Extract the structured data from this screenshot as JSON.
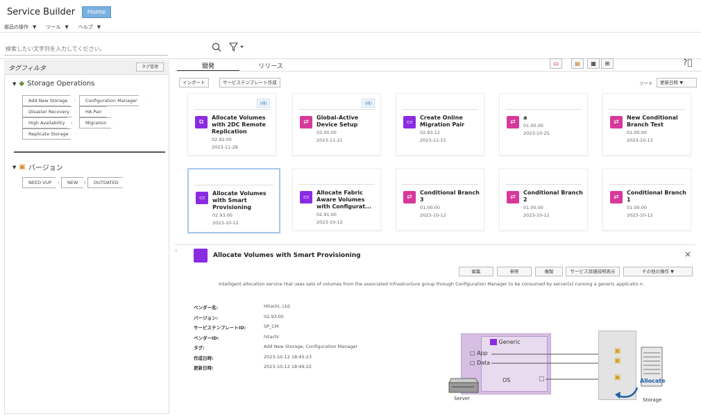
{
  "app": {
    "title": "Service Builder",
    "home_tab": "Home"
  },
  "menu": {
    "items": [
      "部品の操作",
      "ツール",
      "ヘルプ"
    ]
  },
  "search": {
    "placeholder": "検索したい文字列を入力してください。"
  },
  "left": {
    "title": "タグフィルタ",
    "tag_manage": "タグ管理",
    "group1": "Storage Operations",
    "group1_tags": [
      "Add New Storage",
      "Configuration Manager",
      "Disaster Recovery",
      "HA Pair",
      "High Availability",
      "Migration",
      "Replicate Storage"
    ],
    "group2": "バージョン",
    "group2_tags": [
      "NEED VUP",
      "NEW",
      "OUTDATED"
    ]
  },
  "tabs": {
    "dev": "開発",
    "release": "リリース"
  },
  "toolbar": {
    "import": "インポート",
    "create_template": "サービステンプレート作成",
    "sort_label": "ソート",
    "sort_value": "更新日時"
  },
  "cards": [
    {
      "name": "Allocate Volumes with 2DC Remote Replication",
      "version": "02.92.00",
      "date": "2023-11-28",
      "badge": "(排)",
      "color": "#8a2be2"
    },
    {
      "name": "Global-Active Device Setup",
      "version": "03.00.00",
      "date": "2023-11-21",
      "badge": "(排)",
      "color": "#d6399a"
    },
    {
      "name": "Create Online Migration Pair",
      "version": "02.93.12",
      "date": "2023-11-15",
      "badge": "",
      "color": "#8a2be2"
    },
    {
      "name": "a",
      "version": "01.00.00",
      "date": "2023-10-25",
      "badge": "",
      "color": "#d6399a"
    },
    {
      "name": "New Conditional Branch Test",
      "version": "01.00.00",
      "date": "2023-10-13",
      "badge": "",
      "color": "#d6399a"
    },
    {
      "name": "Allocate Volumes with Smart Provisioning",
      "version": "02.93.00",
      "date": "2023-10-12",
      "badge": "",
      "color": "#8a2be2"
    },
    {
      "name": "Allocate Fabric Aware Volumes with Configurat...",
      "version": "02.91.00",
      "date": "2023-10-12",
      "badge": "",
      "color": "#8a2be2"
    },
    {
      "name": "Conditional Branch 3",
      "version": "01.00.00",
      "date": "2023-10-12",
      "badge": "",
      "color": "#d6399a"
    },
    {
      "name": "Conditional Branch 2",
      "version": "01.00.00",
      "date": "2023-10-12",
      "badge": "",
      "color": "#d6399a"
    },
    {
      "name": "Conditional Branch 1",
      "version": "01.00.00",
      "date": "2023-10-12",
      "badge": "",
      "color": "#d6399a"
    }
  ],
  "detail": {
    "title": "Allocate Volumes with Smart Provisioning",
    "buttons": [
      "編集",
      "参照",
      "複製",
      "サービス詳細説明表示",
      "その他の操作"
    ],
    "description": "Intelligent allocation service that uses sets of volumes from the associated infrastructure group through Configuration Manager to be consumed by server(s) running a generic applicatio n.",
    "props": [
      {
        "label": "ベンダー名:",
        "value": "Hitachi, Ltd."
      },
      {
        "label": "バージョン:",
        "value": "02.93.00"
      },
      {
        "label": "サービステンプレートID:",
        "value": "SP_CM"
      },
      {
        "label": "ベンダーID:",
        "value": "hitachi"
      },
      {
        "label": "タグ:",
        "value": "Add New Storage, Configuration Manager"
      },
      {
        "label": "作成日時:",
        "value": "2023-10-12 18:45:23"
      },
      {
        "label": "更新日時:",
        "value": "2023-10-12 18:49:22"
      }
    ],
    "diagram": {
      "generic": "Generic",
      "app": "App",
      "data": "Data",
      "os": "OS",
      "server": "Server",
      "allocate": "Allocate",
      "storage": "Storage"
    }
  }
}
